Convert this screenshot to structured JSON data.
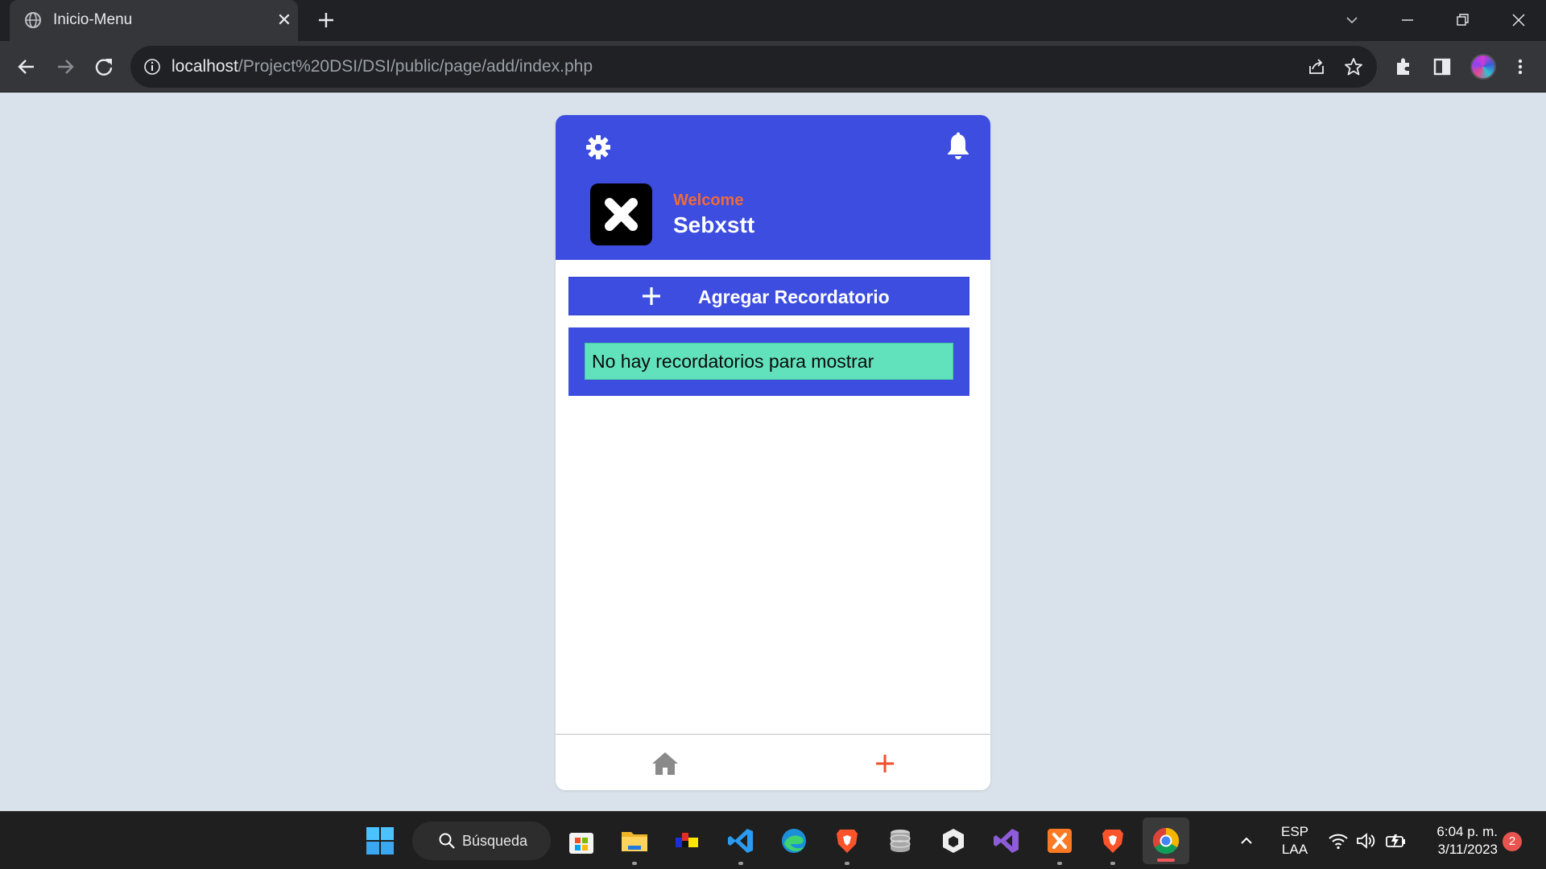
{
  "browser": {
    "tab_title": "Inicio-Menu",
    "url_host": "localhost",
    "url_path": "/Project%20DSI/DSI/public/page/add/index.php"
  },
  "app": {
    "welcome_label": "Welcome",
    "username": "Sebxstt",
    "add_button_label": "Agregar Recordatorio",
    "empty_message": "No hay recordatorios para mostrar",
    "colors": {
      "primary": "#3c4ddf",
      "welcome": "#ee6a3a",
      "empty_bg": "#62e2bc",
      "nav_add": "#f24e2b"
    },
    "icons": [
      "gear-icon",
      "bell-icon",
      "avatar-x-icon",
      "plus-icon",
      "home-icon",
      "nav-add-icon"
    ]
  },
  "taskbar": {
    "search_label": "Búsqueda",
    "lang_top": "ESP",
    "lang_bottom": "LAA",
    "time": "6:04 p. m.",
    "date": "3/11/2023",
    "notification_count": "2"
  }
}
